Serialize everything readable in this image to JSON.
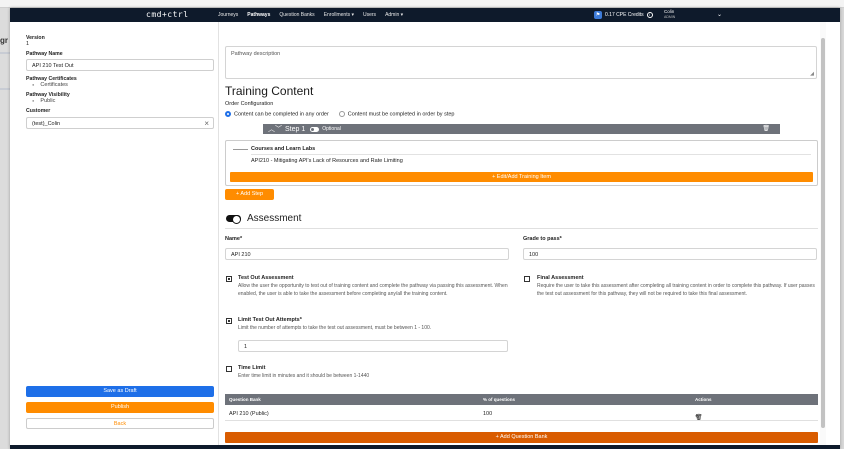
{
  "background": {
    "partial_text": "gr"
  },
  "nav": {
    "logo": "cmd+ctrl",
    "links": [
      "Journeys",
      "Pathways",
      "Question Banks",
      "Enrollments ▾",
      "Users",
      "Admin ▾"
    ],
    "active_link": "Pathways",
    "credits": "0.17 CPE Credits",
    "user_name": "Colin",
    "user_role": "ADMIN"
  },
  "sidebar": {
    "version_label": "Version",
    "version_value": "1",
    "name_label": "Pathway Name",
    "name_value": "API 210 Test Out",
    "certs_label": "Pathway Certificates",
    "certs_value": "Certificates",
    "visibility_label": "Pathway Visibility",
    "visibility_value": "Public",
    "customer_label": "Customer",
    "customer_value": "(test)_Colin",
    "save_draft": "Save as Draft",
    "publish": "Publish",
    "back": "Back"
  },
  "main": {
    "description_placeholder": "Pathway description",
    "training_title": "Training Content",
    "order_label": "Order Configuration",
    "order_any": "Content can be completed in any order",
    "order_step": "Content must be completed in order by step",
    "step_label": "Step 1",
    "step_optional": "Optional",
    "courses_title": "Courses and Learn Labs",
    "course_item": "API210 - Mitigating API's Lack of Resources and Rate Limiting",
    "edit_training": "+ Edit/Add Training Item",
    "add_step": "+ Add Step",
    "assessment_title": "Assessment",
    "name_label": "Name*",
    "name_value": "API 210",
    "grade_label": "Grade to pass*",
    "grade_value": "100",
    "testout_title": "Test Out Assessment",
    "testout_desc": "Allow the user the opportunity to test out of training content and complete the pathway via passing this assessment. When enabled, the user is able to take the assessment before completing any/all the training content.",
    "final_title": "Final Assessment",
    "final_desc": "Require the user to take this assessment after completing all training content in order to complete this pathway. If user passes the test out assessment for this pathway, they will not be required to take this final assessment.",
    "limit_title": "Limit Test Out Attempts*",
    "limit_desc": "Limit the number of attempts to take the test out assessment, must be between 1 - 100.",
    "limit_value": "1",
    "time_title": "Time Limit",
    "time_desc": "Enter time limit in minutes and it should be between 1-1440",
    "qb_headers": [
      "Question Bank",
      "% of questions",
      "Actions"
    ],
    "qb_rows": [
      {
        "bank": "API 210 (Public)",
        "percent": "100"
      }
    ],
    "add_qb": "+ Add Question Bank"
  }
}
